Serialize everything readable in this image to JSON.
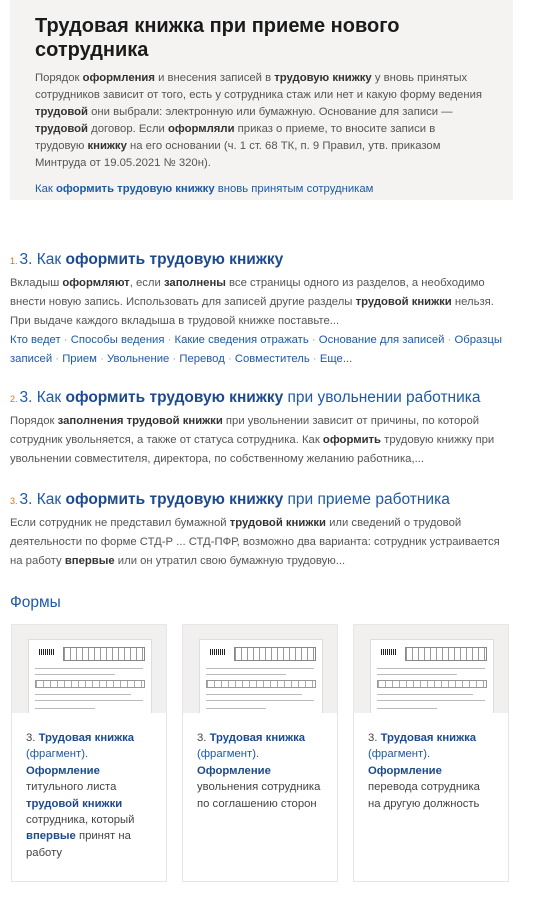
{
  "answer": {
    "title": "Трудовая книжка при приеме нового сотрудника",
    "text_parts": [
      {
        "t": "Порядок ",
        "b": false
      },
      {
        "t": "оформления",
        "b": true
      },
      {
        "t": " и внесения записей в ",
        "b": false
      },
      {
        "t": "трудовую книжку",
        "b": true
      },
      {
        "t": " у вновь принятых сотрудников зависит от того, есть у сотрудника стаж или нет и какую форму ведения ",
        "b": false
      },
      {
        "t": "трудовой",
        "b": true
      },
      {
        "t": " они выбрали: электронную или бумажную. Основание для записи — ",
        "b": false
      },
      {
        "t": "трудовой",
        "b": true
      },
      {
        "t": " договор. Если ",
        "b": false
      },
      {
        "t": "оформляли",
        "b": true
      },
      {
        "t": " приказ о приеме, то вносите записи в трудовую ",
        "b": false
      },
      {
        "t": "книжку",
        "b": true
      },
      {
        "t": " на его основании (ч. 1 ст. 68 ТК, п. 9 Правил, утв. приказом Минтруда от 19.05.2021 № 320н).",
        "b": false
      }
    ],
    "link_prefix": "Как ",
    "link_bold": "оформить трудовую книжку",
    "link_suffix": " вновь принятым сотрудникам"
  },
  "results": [
    {
      "num": "1.",
      "title_prefix": "3. Как ",
      "title_bold": "оформить трудовую книжку",
      "title_suffix": "",
      "snippet_parts": [
        {
          "t": "Вкладыш ",
          "b": false
        },
        {
          "t": "оформляют",
          "b": true
        },
        {
          "t": ", если ",
          "b": false
        },
        {
          "t": "заполнены",
          "b": true
        },
        {
          "t": " все страницы одного из разделов, а необходимо внести новую запись. Использовать для записей другие разделы ",
          "b": false
        },
        {
          "t": "трудовой книжки",
          "b": true
        },
        {
          "t": " нельзя. При выдаче каждого вкладыша в трудовой книжке поставьте...",
          "b": false
        }
      ],
      "tags": [
        "Кто ведет",
        "Способы ведения",
        "Какие сведения отражать",
        "Основание для записей",
        "Образцы записей",
        "Прием",
        "Увольнение",
        "Перевод",
        "Совместитель",
        "Еще..."
      ]
    },
    {
      "num": "2.",
      "title_prefix": "3. Как ",
      "title_bold": "оформить трудовую книжку",
      "title_suffix": " при увольнении работника",
      "snippet_parts": [
        {
          "t": "Порядок ",
          "b": false
        },
        {
          "t": "заполнения трудовой книжки",
          "b": true
        },
        {
          "t": " при увольнении зависит от причины, по которой сотрудник увольняется, а также от статуса сотрудника. Как ",
          "b": false
        },
        {
          "t": "оформить",
          "b": true
        },
        {
          "t": " трудовую книжку при увольнении совместителя, директора, по собственному желанию работника,...",
          "b": false
        }
      ],
      "tags": []
    },
    {
      "num": "3.",
      "title_prefix": "3. Как ",
      "title_bold": "оформить трудовую книжку",
      "title_suffix": " при приеме работника",
      "snippet_parts": [
        {
          "t": "Если сотрудник не представил бумажной ",
          "b": false
        },
        {
          "t": "трудовой книжки",
          "b": true
        },
        {
          "t": " или сведений о трудовой деятельности по форме СТД-Р ... СТД-ПФР, возможно два варианта: сотрудник устраивается на работу ",
          "b": false
        },
        {
          "t": "впервые",
          "b": true
        },
        {
          "t": " или он утратил свою бумажную трудовую...",
          "b": false
        }
      ],
      "tags": []
    }
  ],
  "forms_heading": "Формы",
  "forms": [
    {
      "caption_parts": [
        {
          "t": "3. ",
          "s": "plain"
        },
        {
          "t": "Трудовая книжка",
          "s": "bold"
        },
        {
          "t": " (фрагмент). ",
          "s": "blue"
        },
        {
          "t": "Оформление",
          "s": "bold"
        },
        {
          "t": " титульного листа ",
          "s": "plain"
        },
        {
          "t": "трудовой книжки",
          "s": "bold"
        },
        {
          "t": " сотрудника, который ",
          "s": "plain"
        },
        {
          "t": "впервые",
          "s": "bold"
        },
        {
          "t": " принят на работу",
          "s": "plain"
        }
      ]
    },
    {
      "caption_parts": [
        {
          "t": "3. ",
          "s": "plain"
        },
        {
          "t": "Трудовая книжка",
          "s": "bold"
        },
        {
          "t": " (фрагмент). ",
          "s": "blue"
        },
        {
          "t": "Оформление",
          "s": "bold"
        },
        {
          "t": " увольнения сотрудника по соглашению сторон",
          "s": "plain"
        }
      ]
    },
    {
      "caption_parts": [
        {
          "t": "3. ",
          "s": "plain"
        },
        {
          "t": "Трудовая книжка",
          "s": "bold"
        },
        {
          "t": " (фрагмент). ",
          "s": "blue"
        },
        {
          "t": "Оформление",
          "s": "bold"
        },
        {
          "t": " перевода сотрудника на другую должность",
          "s": "plain"
        }
      ]
    }
  ],
  "colors": {
    "link": "#1d5aa7",
    "link_bold": "#1d4a8e",
    "number_accent": "#e07020",
    "answer_bg": "#f4f3f1"
  }
}
